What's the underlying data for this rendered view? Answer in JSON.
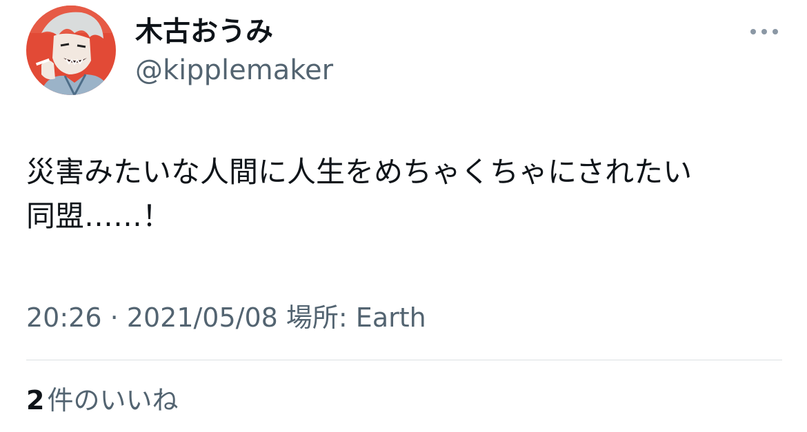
{
  "user": {
    "display_name": "木古おうみ",
    "handle": "@kipplemaker",
    "avatar_icon": "profile-avatar-illustration"
  },
  "tweet": {
    "text_lines": [
      "災害みたいな人間に人生をめちゃくちゃにされたい",
      "同盟……！"
    ],
    "time": "20:26",
    "separator": "·",
    "date": "2021/05/08",
    "location": "場所: Earth"
  },
  "stats": {
    "likes_count": "2",
    "likes_label": "件のいいね"
  },
  "icons": {
    "more": "more-options-icon"
  },
  "colors": {
    "text_primary": "#0f1419",
    "text_secondary": "#536471",
    "divider": "#dcdfe2",
    "avatar_bg": "#e24a36"
  }
}
